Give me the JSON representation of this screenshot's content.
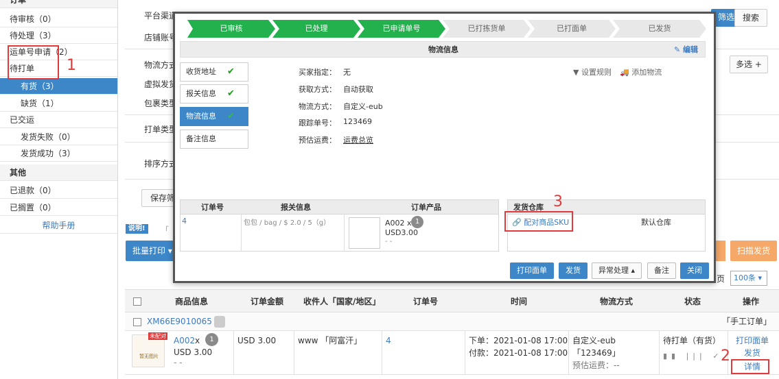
{
  "sidebar": {
    "cut_header": "订单",
    "items": [
      {
        "label": "待审核（0）"
      },
      {
        "label": "待处理（3）"
      },
      {
        "label": "运单号申请（2）"
      },
      {
        "label": "待打单"
      },
      {
        "label": "有货（3）"
      },
      {
        "label": "缺货（1）"
      },
      {
        "label": "已交运"
      },
      {
        "label": "发货失败（0）"
      },
      {
        "label": "发货成功（3）"
      },
      {
        "label": "其他"
      },
      {
        "label": "已退款（0）"
      },
      {
        "label": "已搁置（0）"
      },
      {
        "label": "帮助手册"
      }
    ]
  },
  "filters": {
    "platform_label": "平台渠道",
    "shop_label": "店铺账号",
    "logistics_label": "物流方式",
    "virtual_label": "虚拟发货",
    "package_label": "包裹类型",
    "print_label": "打单类型",
    "sort_label": "排序方式",
    "save_btn": "保存筛",
    "filter_btn": "筛选",
    "search_btn": "搜索",
    "multi_btn": "多选 +",
    "note_tag": "说明!",
    "note_text": "「",
    "batch_print_btn": "批量打印 ▾",
    "scan_ship_btn": "扫描发货",
    "per_page_prefix": "页",
    "per_page_select": "100条 ▾"
  },
  "table": {
    "headers": [
      "商品信息",
      "订单金额",
      "收件人「国家/地区」",
      "订单号",
      "时间",
      "物流方式",
      "状态",
      "操作"
    ],
    "order_no": "XM66E9010065",
    "order_type": "「手工订单」",
    "row": {
      "badge": "未配对",
      "img_text": "暂无图片",
      "sku": "A002",
      "times": "x",
      "qty": "1",
      "price": "USD 3.00",
      "dash": "- -",
      "amount": "USD 3.00",
      "receiver": "www 「阿富汗」",
      "order_id": "4",
      "order_time": "下单：2021-01-08 17:00",
      "pay_time": "付款：2021-01-08 17:00",
      "logistics": "自定义-eub",
      "tracking": "「123469」",
      "freight": "预估运费：--",
      "status": "待打单（有货）",
      "op_print": "打印面单",
      "op_ship": "发货",
      "op_detail": "详情"
    }
  },
  "modal": {
    "steps": [
      "已审核",
      "已处理",
      "已申请单号",
      "已打拣货单",
      "已打面单",
      "已发货"
    ],
    "section_title": "物流信息",
    "edit": "编辑",
    "tabs": [
      "收货地址",
      "报关信息",
      "物流信息",
      "备注信息"
    ],
    "fields": [
      {
        "label": "买家指定：",
        "value": "无"
      },
      {
        "label": "获取方式：",
        "value": "自动获取"
      },
      {
        "label": "物流方式：",
        "value": "自定义-eub"
      },
      {
        "label": "跟踪单号：",
        "value": "123469"
      },
      {
        "label": "预估运费：",
        "value": "运费总览"
      }
    ],
    "set_rule": "设置规则",
    "add_logistics": "添加物流",
    "table_headers": [
      "订单号",
      "报关信息",
      "订单产品"
    ],
    "warehouse_header": "发货仓库",
    "table_row": {
      "order_no": "4",
      "customs": "包包 / bag / $ 2.0 / 5（g）",
      "product": "A002 x",
      "qty": "1",
      "price": "USD3.00",
      "dash": "- -",
      "match_sku": "配对商品SKU",
      "default_wh": "默认仓库"
    },
    "buttons": [
      "打印面单",
      "发货",
      "异常处理 ▴",
      "备注",
      "关闭"
    ]
  },
  "annotations": [
    "1",
    "2",
    "3"
  ],
  "colors": {
    "primary_blue": "#3d86c8",
    "step_green": "#22b14c",
    "annotation_red": "#e23a3a",
    "scan_orange": "#f5a868"
  }
}
